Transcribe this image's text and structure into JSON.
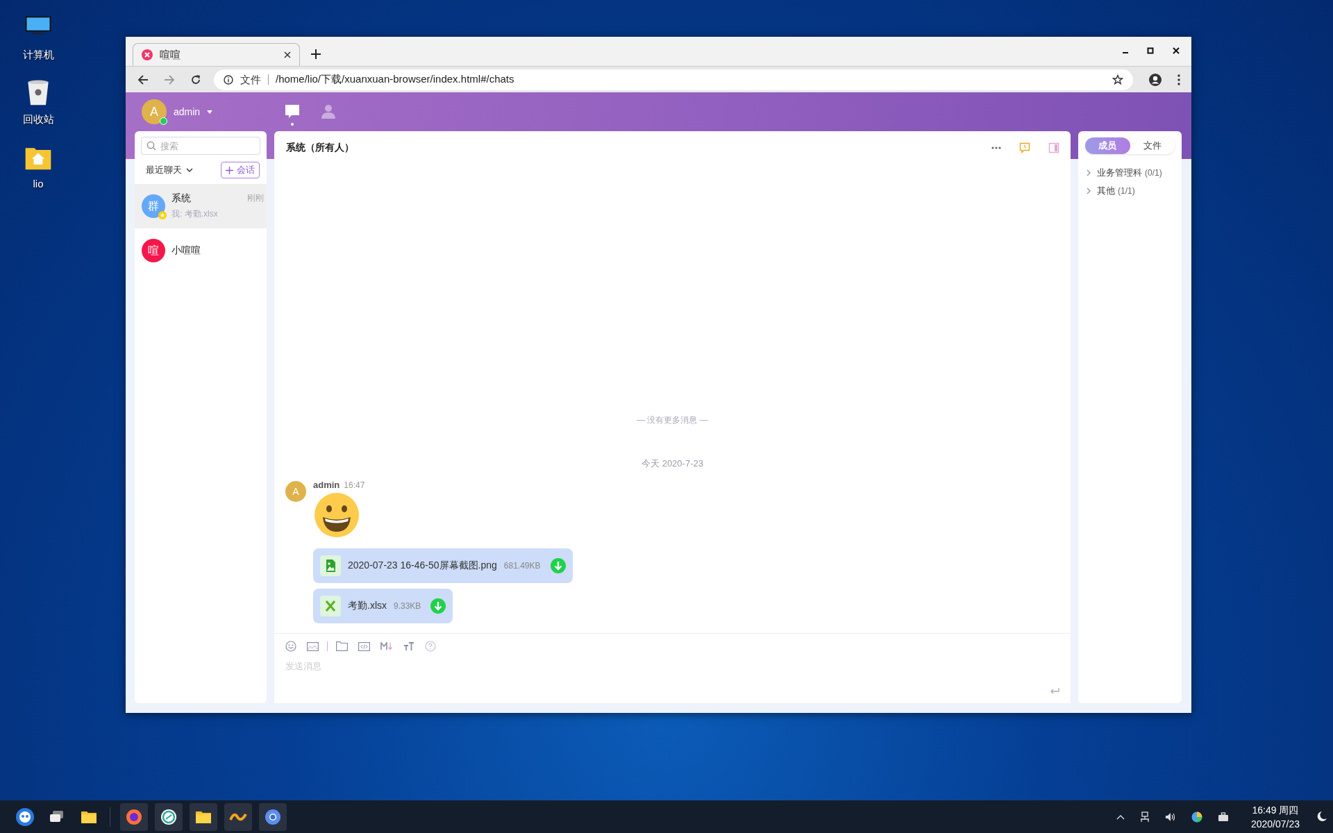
{
  "desktop_icons": [
    {
      "kind": "computer",
      "label": "计算机"
    },
    {
      "kind": "trash",
      "label": "回收站"
    },
    {
      "kind": "home",
      "label": "lio"
    }
  ],
  "browser": {
    "tab": {
      "title": "喧喧"
    },
    "address": {
      "prefix": "文件",
      "url": "/home/lio/下载/xuanxuan-browser/index.html#/chats"
    }
  },
  "app": {
    "user": {
      "avatar": "A",
      "name": "admin",
      "online": true
    },
    "nav": [
      {
        "kind": "chats",
        "selected": true
      },
      {
        "kind": "contacts",
        "selected": false
      }
    ],
    "search": {
      "placeholder": "搜索"
    },
    "list_filter": "最近聊天",
    "new_chat_button": "会话",
    "chats": [
      {
        "avatar": "群",
        "color": "#64a8f8",
        "name": "系统",
        "time": "刚刚",
        "preview": "我: 考勤.xlsx",
        "starred": true,
        "selected": true
      },
      {
        "avatar": "喧",
        "color": "#f5174b",
        "name": "小喧喧",
        "starred": false,
        "selected": false
      }
    ],
    "chat": {
      "title": "系统（所有人）",
      "no_more": "— 没有更多消息 —",
      "date": "今天 2020-7-23",
      "messages": [
        {
          "avatar": "A",
          "sender": "admin",
          "time": "16:47",
          "items": [
            {
              "kind": "emoji"
            },
            {
              "kind": "image_file",
              "name": "2020-07-23 16-46-50屏幕截图.png",
              "size": "681.49KB"
            },
            {
              "kind": "excel_file",
              "name": "考勤.xlsx",
              "size": "9.33KB"
            }
          ]
        }
      ],
      "input": {
        "placeholder": "发送消息"
      }
    },
    "side_tabs": [
      {
        "label": "成员",
        "selected": true
      },
      {
        "label": "文件",
        "selected": false
      }
    ],
    "groups": [
      {
        "name": "业务管理科",
        "count": "(0/1)"
      },
      {
        "name": "其他",
        "count": "(1/1)"
      }
    ]
  },
  "taskbar": {
    "apps": [
      {
        "kind": "launcher"
      },
      {
        "kind": "multitask"
      },
      {
        "kind": "folder"
      },
      {
        "kind": "firefox"
      },
      {
        "kind": "store"
      },
      {
        "kind": "folder"
      },
      {
        "kind": "music"
      },
      {
        "kind": "chromium"
      }
    ],
    "clock": {
      "time": "16:49 周四",
      "date": "2020/07/23"
    }
  }
}
